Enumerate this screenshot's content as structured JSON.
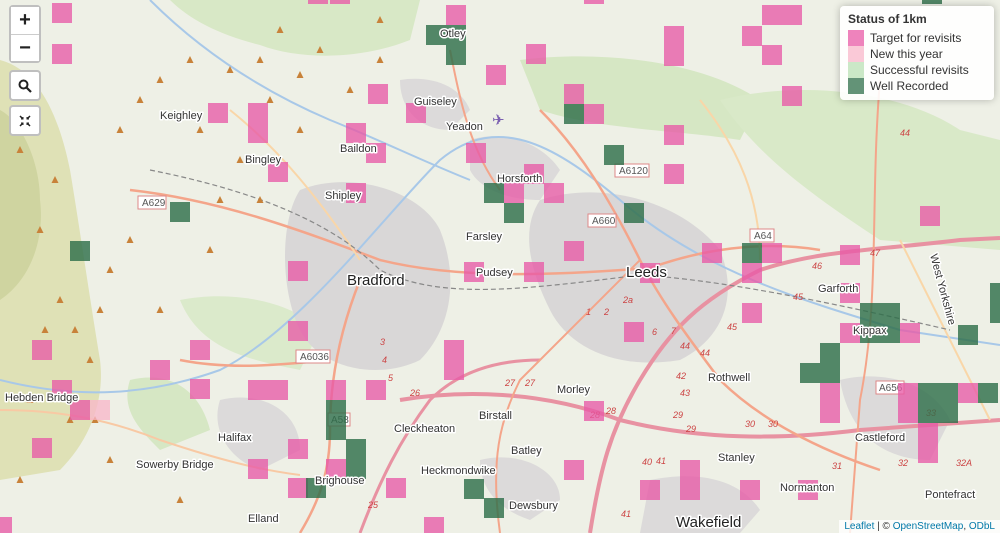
{
  "zoom": {
    "in_label": "+",
    "out_label": "−"
  },
  "controls": {
    "search_icon": "search-icon",
    "fullscreen_icon": "fullscreen-icon"
  },
  "legend": {
    "title": "Status of 1km",
    "items": [
      {
        "label": "Target for revisits",
        "color": "#e85aa6"
      },
      {
        "label": "New this year",
        "color": "#f8b7c9"
      },
      {
        "label": "Successful revisits",
        "color": "#b9e0b4"
      },
      {
        "label": "Well Recorded",
        "color": "#2f6f4a"
      }
    ]
  },
  "attribution": {
    "leaflet": "Leaflet",
    "sep": " | © ",
    "osm": "OpenStreetMap",
    "sep2": ", ",
    "odbl": "ODbL"
  },
  "places": {
    "otley": "Otley",
    "keighley": "Keighley",
    "guiseley": "Guiseley",
    "yeadon": "Yeadon",
    "bingley": "Bingley",
    "baildon": "Baildon",
    "horsforth": "Horsforth",
    "shipley": "Shipley",
    "farsley": "Farsley",
    "bradford": "Bradford",
    "pudsey": "Pudsey",
    "leeds": "Leeds",
    "garforth": "Garforth",
    "kippax": "Kippax",
    "rothwell": "Rothwell",
    "morley": "Morley",
    "hebden_bridge": "Hebden Bridge",
    "halifax": "Halifax",
    "cleckheaton": "Cleckheaton",
    "birstall": "Birstall",
    "batley": "Batley",
    "castleford": "Castleford",
    "sowerby_bridge": "Sowerby Bridge",
    "heckmondwike": "Heckmondwike",
    "stanley": "Stanley",
    "brighouse": "Brighouse",
    "normanton": "Normanton",
    "pontefract": "Pontefract",
    "elland": "Elland",
    "dewsbury": "Dewsbury",
    "wakefield": "Wakefield",
    "west_yorkshire": "West Yorkshire"
  },
  "roads": {
    "a629": "A629",
    "a6120": "A6120",
    "a660": "A660",
    "a64": "A64",
    "a6036": "A6036",
    "a58": "A58",
    "a656": "A656"
  },
  "junctions": [
    "44",
    "47",
    "46",
    "45",
    "42",
    "43",
    "44",
    "41",
    "30",
    "29",
    "28",
    "27",
    "26",
    "25",
    "2a",
    "2",
    "1",
    "6",
    "7",
    "3",
    "4",
    "5",
    "32",
    "32A",
    "31",
    "33",
    "40",
    "41",
    "44"
  ]
}
